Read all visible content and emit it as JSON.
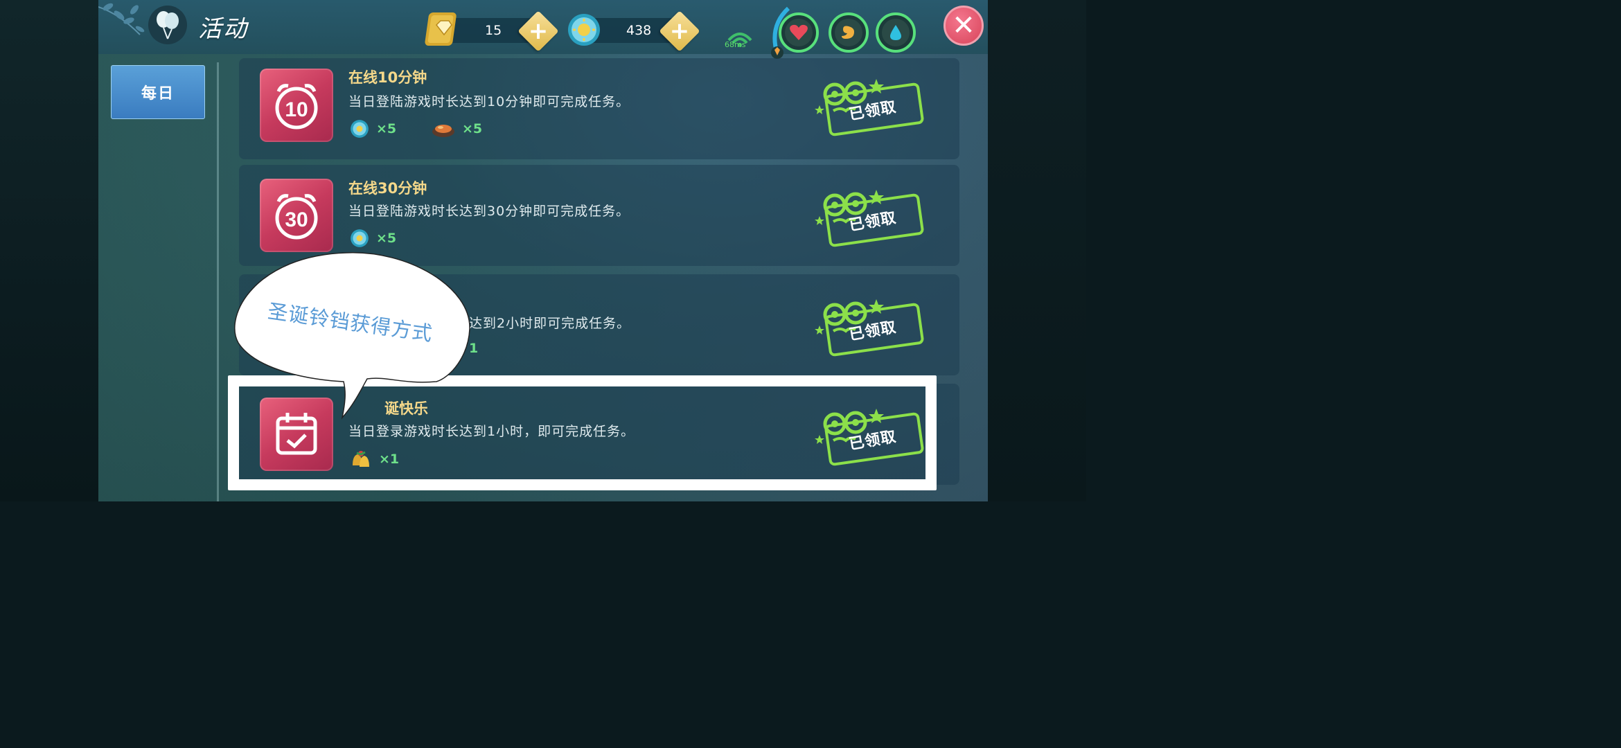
{
  "header": {
    "title": "活动",
    "title_icon": "balloon-icon",
    "diamonds": "15",
    "diamond_icon": "diamond-gem-icon",
    "coins": "438",
    "coin_icon": "sun-coin-icon",
    "ping": "68ms",
    "stats": [
      "heart-icon",
      "stomach-icon",
      "water-drop-icon"
    ],
    "close_label": "✕"
  },
  "sidebar": {
    "tabs": [
      {
        "label": "每日",
        "selected": true
      }
    ]
  },
  "tasks": [
    {
      "title": "在线10分钟",
      "icon_number": "10",
      "description": "当日登陆游戏时长达到10分钟即可完成任务。",
      "rewards": [
        {
          "icon": "sun-coin-icon",
          "qty": "×5"
        },
        {
          "icon": "food-plate-icon",
          "qty": "×5"
        }
      ],
      "status": "已领取"
    },
    {
      "title": "在线30分钟",
      "icon_number": "30",
      "description": "当日登陆游戏时长达到30分钟即可完成任务。",
      "rewards": [
        {
          "icon": "sun-coin-icon",
          "qty": "×5"
        }
      ],
      "status": "已领取"
    },
    {
      "title": "",
      "description": "达到2小时即可完成任务。",
      "rewards": [
        {
          "icon": "",
          "qty": "1"
        }
      ],
      "status": "已领取"
    },
    {
      "title": "诞快乐",
      "description": "当日登录游戏时长达到1小时，即可完成任务。",
      "rewards": [
        {
          "icon": "jingle-bell-icon",
          "qty": "×1"
        }
      ],
      "status": "已领取"
    }
  ],
  "annotation": {
    "bubble_text": "圣诞铃铛获得方式"
  },
  "colors": {
    "title_gold": "#f5d88a",
    "reward_green": "#6ee08a",
    "claimed_green": "#8ce04a",
    "card_icon_pink": "#d84a6c",
    "tab_blue": "#4a8ecc",
    "close_red": "#e05870",
    "bubble_text_blue": "#5a9bd6"
  }
}
